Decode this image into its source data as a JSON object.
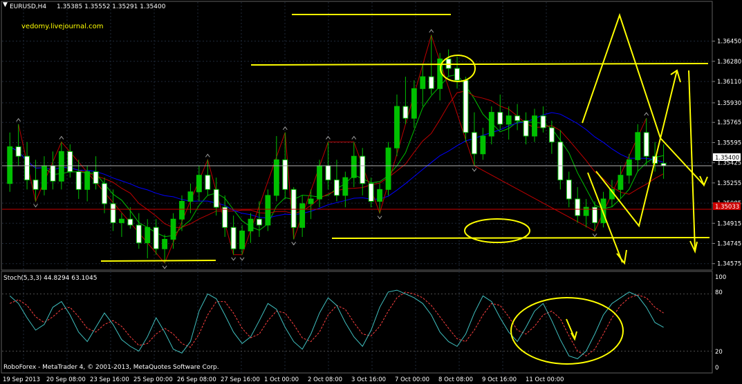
{
  "header": {
    "symbol_label": "EURUSD,H4",
    "ohlc": "1.35385 1.35552 1.35291 1.35400",
    "watermark": "vedomy.livejournal.com"
  },
  "indicator": {
    "label": "Stoch(5,3,3) 44.8294 63.1045",
    "levels": [
      "100",
      "80",
      "20",
      "0"
    ]
  },
  "footer": {
    "copyright": "RoboForex - MetaTrader 4, © 2001-2013, MetaQuotes Software Corp."
  },
  "colors": {
    "background": "#000000",
    "grid": "#1f2a3a",
    "bull": "#ffffff",
    "bear": "#00c000",
    "wick": "#00c000",
    "annotation": "#ffff00",
    "ma_fast": "#00c000",
    "ma_mid": "#c00000",
    "ma_slow": "#0000ff",
    "zigzag": "#c00000",
    "stoch_main": "#40c0c0",
    "stoch_signal": "#ff4040",
    "price_line_bg": "#cc0000",
    "current_price_bg": "#ffffff"
  },
  "chart_data": {
    "type": "candlestick",
    "symbol": "EURUSD",
    "timeframe": "H4",
    "ylim": [
      1.3455,
      1.3675
    ],
    "y_ticks": [
      "1.36450",
      "1.36280",
      "1.36110",
      "1.35930",
      "1.35765",
      "1.35595",
      "1.35425",
      "1.35255",
      "1.35085",
      "1.34915",
      "1.34745",
      "1.34575"
    ],
    "current_price": "1.35400",
    "marked_price": "1.35033",
    "x_ticks": [
      "19 Sep 2013",
      "20 Sep 08:00",
      "23 Sep 16:00",
      "25 Sep 00:00",
      "26 Sep 08:00",
      "27 Sep 16:00",
      "1 Oct 00:00",
      "2 Oct 08:00",
      "3 Oct 16:00",
      "7 Oct 00:00",
      "8 Oct 08:00",
      "9 Oct 16:00",
      "11 Oct 00:00"
    ],
    "candles": [
      [
        1.3525,
        1.3568,
        1.3518,
        1.3556
      ],
      [
        1.3556,
        1.3575,
        1.354,
        1.3548
      ],
      [
        1.3548,
        1.356,
        1.352,
        1.3528
      ],
      [
        1.3528,
        1.3545,
        1.351,
        1.352
      ],
      [
        1.352,
        1.3548,
        1.3515,
        1.354
      ],
      [
        1.354,
        1.3552,
        1.352,
        1.3527
      ],
      [
        1.3527,
        1.356,
        1.352,
        1.3552
      ],
      [
        1.3552,
        1.3558,
        1.353,
        1.3535
      ],
      [
        1.3535,
        1.3545,
        1.3512,
        1.352
      ],
      [
        1.352,
        1.354,
        1.351,
        1.3535
      ],
      [
        1.3535,
        1.3548,
        1.352,
        1.3525
      ],
      [
        1.3525,
        1.353,
        1.35,
        1.3508
      ],
      [
        1.3508,
        1.352,
        1.3485,
        1.3492
      ],
      [
        1.3492,
        1.35,
        1.348,
        1.3495
      ],
      [
        1.3495,
        1.3505,
        1.3487,
        1.349
      ],
      [
        1.349,
        1.35,
        1.347,
        1.3475
      ],
      [
        1.3475,
        1.3495,
        1.3462,
        1.3488
      ],
      [
        1.3488,
        1.3495,
        1.3465,
        1.347
      ],
      [
        1.347,
        1.3482,
        1.3458,
        1.3478
      ],
      [
        1.3478,
        1.35,
        1.347,
        1.3495
      ],
      [
        1.3495,
        1.3515,
        1.3485,
        1.351
      ],
      [
        1.351,
        1.3525,
        1.35,
        1.3518
      ],
      [
        1.3518,
        1.354,
        1.351,
        1.3532
      ],
      [
        1.3532,
        1.3545,
        1.3515,
        1.352
      ],
      [
        1.352,
        1.353,
        1.3498,
        1.3505
      ],
      [
        1.3505,
        1.3515,
        1.348,
        1.3488
      ],
      [
        1.3488,
        1.3498,
        1.3465,
        1.347
      ],
      [
        1.347,
        1.349,
        1.3465,
        1.3485
      ],
      [
        1.3485,
        1.35,
        1.3475,
        1.3495
      ],
      [
        1.3495,
        1.351,
        1.348,
        1.349
      ],
      [
        1.349,
        1.352,
        1.3485,
        1.3515
      ],
      [
        1.3515,
        1.3565,
        1.351,
        1.3545
      ],
      [
        1.3545,
        1.3568,
        1.3512,
        1.352
      ],
      [
        1.352,
        1.3522,
        1.3478,
        1.3488
      ],
      [
        1.3488,
        1.3515,
        1.348,
        1.3508
      ],
      [
        1.3508,
        1.352,
        1.3495,
        1.3512
      ],
      [
        1.3512,
        1.3545,
        1.3505,
        1.354
      ],
      [
        1.354,
        1.356,
        1.352,
        1.3528
      ],
      [
        1.3528,
        1.3545,
        1.351,
        1.3515
      ],
      [
        1.3515,
        1.3535,
        1.3505,
        1.353
      ],
      [
        1.353,
        1.356,
        1.3522,
        1.3548
      ],
      [
        1.3548,
        1.3555,
        1.3515,
        1.3525
      ],
      [
        1.3525,
        1.353,
        1.3505,
        1.351
      ],
      [
        1.351,
        1.3525,
        1.35,
        1.352
      ],
      [
        1.352,
        1.356,
        1.3515,
        1.3555
      ],
      [
        1.3555,
        1.36,
        1.3548,
        1.359
      ],
      [
        1.359,
        1.3615,
        1.3575,
        1.358
      ],
      [
        1.358,
        1.3612,
        1.3572,
        1.3605
      ],
      [
        1.3605,
        1.3625,
        1.359,
        1.3615
      ],
      [
        1.3615,
        1.365,
        1.36,
        1.3605
      ],
      [
        1.3605,
        1.3635,
        1.3595,
        1.363
      ],
      [
        1.363,
        1.3638,
        1.3615,
        1.3622
      ],
      [
        1.3622,
        1.3632,
        1.3605,
        1.3612
      ],
      [
        1.3612,
        1.3615,
        1.356,
        1.3568
      ],
      [
        1.3568,
        1.3585,
        1.354,
        1.355
      ],
      [
        1.355,
        1.3572,
        1.3545,
        1.3565
      ],
      [
        1.3565,
        1.359,
        1.3558,
        1.3585
      ],
      [
        1.3585,
        1.36,
        1.357,
        1.3575
      ],
      [
        1.3575,
        1.359,
        1.3562,
        1.3582
      ],
      [
        1.3582,
        1.3592,
        1.357,
        1.3578
      ],
      [
        1.3578,
        1.3585,
        1.3558,
        1.3565
      ],
      [
        1.3565,
        1.3588,
        1.356,
        1.3582
      ],
      [
        1.3582,
        1.359,
        1.3568,
        1.3572
      ],
      [
        1.3572,
        1.3578,
        1.355,
        1.356
      ],
      [
        1.356,
        1.357,
        1.352,
        1.3528
      ],
      [
        1.3528,
        1.3535,
        1.3505,
        1.3512
      ],
      [
        1.3512,
        1.3522,
        1.3492,
        1.3498
      ],
      [
        1.3498,
        1.3512,
        1.3488,
        1.3505
      ],
      [
        1.3505,
        1.351,
        1.3485,
        1.3492
      ],
      [
        1.3492,
        1.3518,
        1.3488,
        1.3512
      ],
      [
        1.3512,
        1.3528,
        1.3505,
        1.352
      ],
      [
        1.352,
        1.354,
        1.3512,
        1.3532
      ],
      [
        1.3532,
        1.355,
        1.3525,
        1.3545
      ],
      [
        1.3545,
        1.3575,
        1.3535,
        1.3568
      ],
      [
        1.3568,
        1.358,
        1.354,
        1.3548
      ],
      [
        1.3548,
        1.356,
        1.3535,
        1.3542
      ],
      [
        1.3542,
        1.3558,
        1.3529,
        1.354
      ]
    ],
    "stoch_main": [
      78,
      70,
      55,
      42,
      48,
      66,
      72,
      58,
      40,
      30,
      45,
      60,
      48,
      32,
      25,
      20,
      35,
      55,
      40,
      22,
      18,
      30,
      62,
      80,
      75,
      58,
      40,
      28,
      35,
      52,
      70,
      64,
      45,
      30,
      22,
      38,
      60,
      76,
      68,
      50,
      35,
      25,
      42,
      66,
      82,
      84,
      80,
      76,
      70,
      58,
      40,
      30,
      25,
      38,
      60,
      78,
      72,
      55,
      40,
      30,
      45,
      62,
      70,
      52,
      32,
      15,
      12,
      20,
      38,
      58,
      70,
      76,
      82,
      78,
      66,
      50,
      45
    ],
    "stoch_signal": [
      70,
      74,
      68,
      56,
      50,
      56,
      64,
      66,
      56,
      44,
      40,
      48,
      52,
      46,
      35,
      26,
      28,
      38,
      44,
      38,
      28,
      24,
      38,
      58,
      72,
      72,
      60,
      44,
      34,
      38,
      52,
      62,
      60,
      48,
      34,
      30,
      40,
      58,
      68,
      64,
      50,
      38,
      36,
      46,
      62,
      76,
      82,
      80,
      76,
      68,
      56,
      44,
      33,
      30,
      42,
      58,
      70,
      68,
      56,
      42,
      38,
      46,
      58,
      62,
      54,
      36,
      20,
      15,
      22,
      38,
      55,
      68,
      76,
      79,
      76,
      66,
      60
    ]
  }
}
